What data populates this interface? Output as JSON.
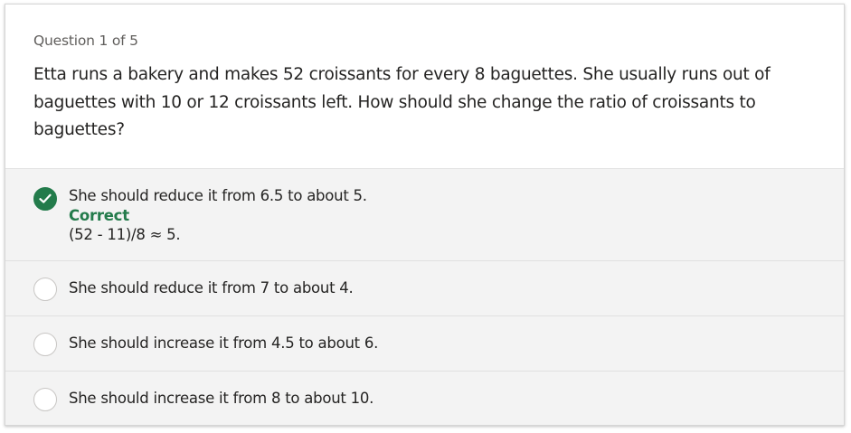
{
  "quiz": {
    "question_counter": "Question 1 of 5",
    "question_text": "Etta runs a bakery and makes 52 croissants for every 8 baguettes. She usually runs out of baguettes with 10 or 12 croissants left. How should she change the ratio of croissants to baguettes?",
    "options": [
      {
        "label": "She should reduce it from 6.5 to about 5.",
        "state": "correct",
        "feedback_title": "Correct",
        "feedback_explanation": "(52 - 11)/8 ≈ 5."
      },
      {
        "label": "She should reduce it from 7 to about 4.",
        "state": "unselected"
      },
      {
        "label": "She should increase it from 4.5 to about 6.",
        "state": "unselected"
      },
      {
        "label": "She should increase it from 8 to about 10.",
        "state": "unselected"
      }
    ]
  },
  "colors": {
    "correct_accent": "#237b4b",
    "option_background": "#f3f3f3",
    "text_primary": "#252423",
    "text_secondary": "#605e5c"
  },
  "icons": {
    "correct_indicator": "checkmark-icon",
    "unselected_indicator": "radio-circle"
  }
}
